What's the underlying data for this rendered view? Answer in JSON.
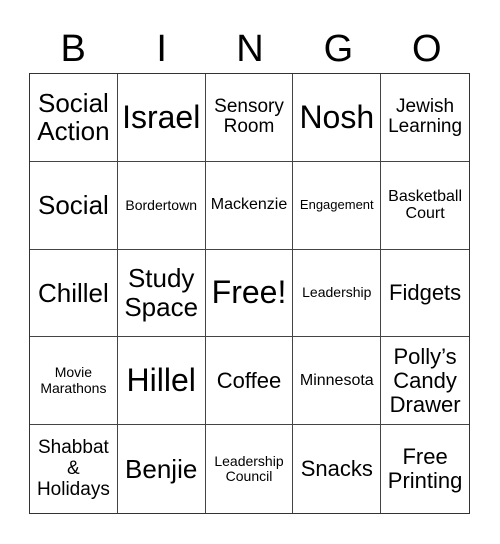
{
  "header": [
    "B",
    "I",
    "N",
    "G",
    "O"
  ],
  "cells": [
    {
      "text": "Social Action",
      "size": "s-l"
    },
    {
      "text": "Israel",
      "size": "s-xl"
    },
    {
      "text": "Sensory Room",
      "size": "s-m"
    },
    {
      "text": "Nosh",
      "size": "s-xl"
    },
    {
      "text": "Jewish Learning",
      "size": "s-m"
    },
    {
      "text": "Social",
      "size": "s-l"
    },
    {
      "text": "Bordertown",
      "size": "s-xs"
    },
    {
      "text": "Mackenzie",
      "size": "s-s"
    },
    {
      "text": "Engagement",
      "size": "s-xxs"
    },
    {
      "text": "Basketball Court",
      "size": "s-s"
    },
    {
      "text": "Chillel",
      "size": "s-l"
    },
    {
      "text": "Study Space",
      "size": "s-l"
    },
    {
      "text": "Free!",
      "size": "s-xl"
    },
    {
      "text": "Leadership",
      "size": "s-xs"
    },
    {
      "text": "Fidgets",
      "size": "s-ml"
    },
    {
      "text": "Movie Marathons",
      "size": "s-xs"
    },
    {
      "text": "Hillel",
      "size": "s-xl"
    },
    {
      "text": "Coffee",
      "size": "s-ml"
    },
    {
      "text": "Minnesota",
      "size": "s-s"
    },
    {
      "text": "Polly’s Candy Drawer",
      "size": "s-ml"
    },
    {
      "text": "Shabbat & Holidays",
      "size": "s-m"
    },
    {
      "text": "Benjie",
      "size": "s-l"
    },
    {
      "text": "Leadership Council",
      "size": "s-xs"
    },
    {
      "text": "Snacks",
      "size": "s-ml"
    },
    {
      "text": "Free Printing",
      "size": "s-ml"
    }
  ]
}
